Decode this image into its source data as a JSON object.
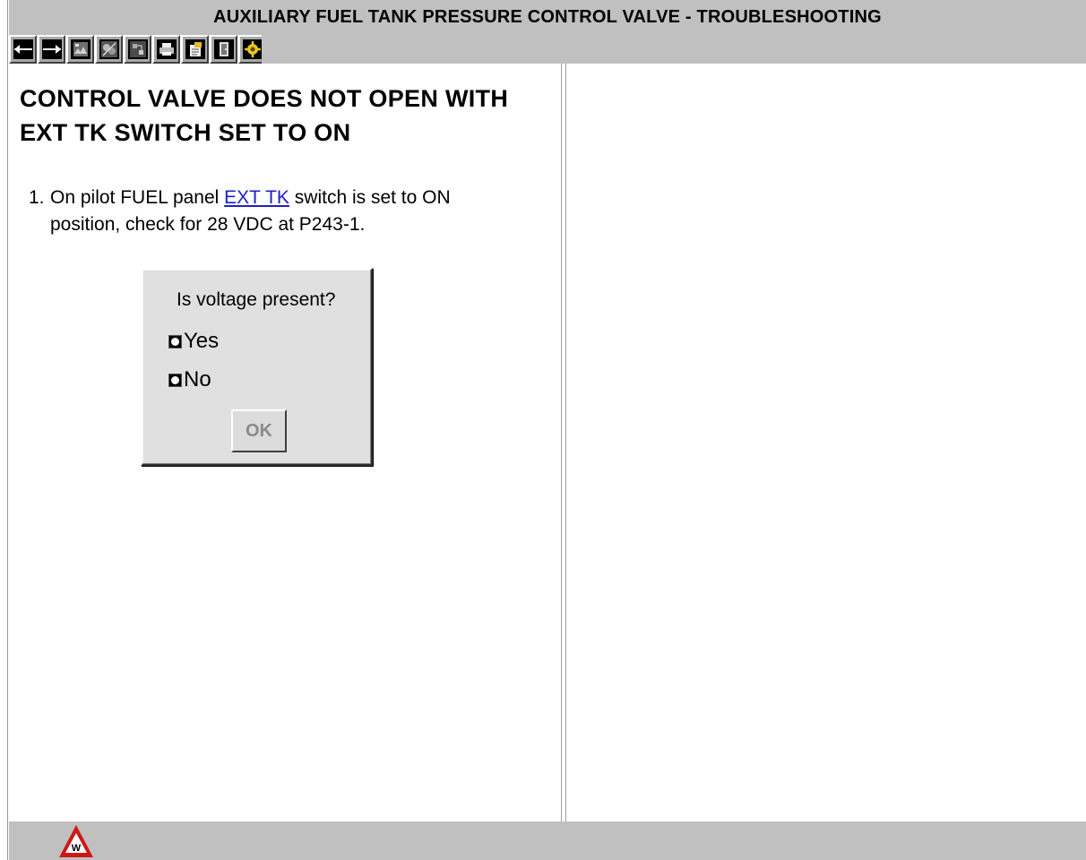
{
  "window": {
    "title": "AUXILIARY FUEL TANK PRESSURE CONTROL VALVE - TROUBLESHOOTING"
  },
  "toolbar": {
    "buttons": [
      {
        "icon": "back-arrow-icon"
      },
      {
        "icon": "forward-arrow-icon"
      },
      {
        "icon": "image-icon"
      },
      {
        "icon": "diagram-icon"
      },
      {
        "icon": "schematic-icon"
      },
      {
        "icon": "print-icon"
      },
      {
        "icon": "notes-icon"
      },
      {
        "icon": "exit-icon"
      },
      {
        "icon": "tools-icon"
      }
    ]
  },
  "procedure": {
    "heading": "CONTROL VALVE DOES NOT OPEN WITH EXT TK SWITCH SET TO ON",
    "step": {
      "number": "1.",
      "text_before": "On pilot FUEL panel",
      "link": "EXT TK",
      "text_after": "switch is set to ON",
      "line2": "position, check for 28 VDC at P243-1."
    }
  },
  "dialog": {
    "question": "Is voltage present?",
    "options": [
      "Yes",
      "No"
    ],
    "ok_label": "OK"
  },
  "status_bar": {
    "warning_letter": "W"
  },
  "colors": {
    "chrome": "#c0c0c0",
    "link": "#2020c8",
    "warning": "#d01818"
  }
}
